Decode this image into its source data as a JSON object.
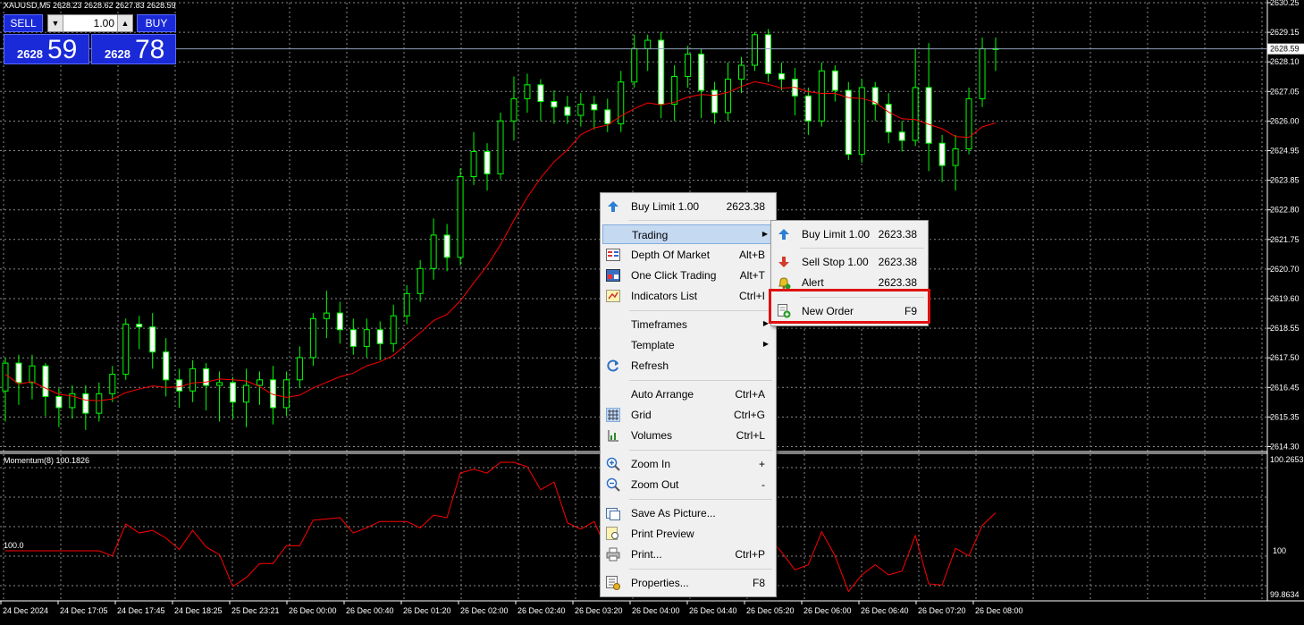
{
  "symbol_header": "XAUUSD,M5  2628.23 2628.62 2627.83 2628.59",
  "trade_panel": {
    "sell_label": "SELL",
    "buy_label": "BUY",
    "lot": "1.00",
    "sell_price_small": "2628",
    "sell_price_big": "59",
    "buy_price_small": "2628",
    "buy_price_big": "78"
  },
  "price_axis": [
    "2630.25",
    "2629.15",
    "2628.10",
    "2627.05",
    "2626.00",
    "2624.95",
    "2623.85",
    "2622.80",
    "2621.75",
    "2620.70",
    "2619.60",
    "2618.55",
    "2617.50",
    "2616.45",
    "2615.35",
    "2614.30"
  ],
  "current_price_label": "2628.59",
  "indicator": {
    "title": "Momentum(8) 100.1826",
    "level_label": "100.0",
    "axis": [
      "100.2653",
      "100",
      "99.8634"
    ]
  },
  "time_axis": [
    "24 Dec 2024",
    "24 Dec 17:05",
    "24 Dec 17:45",
    "24 Dec 18:25",
    "25 Dec 23:21",
    "26 Dec 00:00",
    "26 Dec 00:40",
    "26 Dec 01:20",
    "26 Dec 02:00",
    "26 Dec 02:40",
    "26 Dec 03:20",
    "26 Dec 04:00",
    "26 Dec 04:40",
    "26 Dec 05:20",
    "26 Dec 06:00",
    "26 Dec 06:40",
    "26 Dec 07:20",
    "26 Dec 08:00"
  ],
  "context_menu": {
    "buy_limit": {
      "label": "Buy Limit 1.00",
      "value": "2623.38"
    },
    "trading": "Trading",
    "depth_of_market": {
      "label": "Depth Of Market",
      "shortcut": "Alt+B"
    },
    "one_click_trading": {
      "label": "One Click Trading",
      "shortcut": "Alt+T"
    },
    "indicators_list": {
      "label": "Indicators List",
      "shortcut": "Ctrl+I"
    },
    "timeframes": "Timeframes",
    "template": "Template",
    "refresh": "Refresh",
    "auto_arrange": {
      "label": "Auto Arrange",
      "shortcut": "Ctrl+A"
    },
    "grid": {
      "label": "Grid",
      "shortcut": "Ctrl+G"
    },
    "volumes": {
      "label": "Volumes",
      "shortcut": "Ctrl+L"
    },
    "zoom_in": {
      "label": "Zoom In",
      "shortcut": "+"
    },
    "zoom_out": {
      "label": "Zoom Out",
      "shortcut": "-"
    },
    "save_as_picture": "Save As Picture...",
    "print_preview": "Print Preview",
    "print": {
      "label": "Print...",
      "shortcut": "Ctrl+P"
    },
    "properties": {
      "label": "Properties...",
      "shortcut": "F8"
    }
  },
  "submenu": {
    "buy_limit": {
      "label": "Buy Limit 1.00",
      "value": "2623.38"
    },
    "sell_stop": {
      "label": "Sell Stop 1.00",
      "value": "2623.38"
    },
    "alert": {
      "label": "Alert",
      "value": "2623.38"
    },
    "new_order": {
      "label": "New Order",
      "shortcut": "F9"
    }
  },
  "colors": {
    "bull": "#00ff00",
    "ma": "#ff0000",
    "grid": "#8a8a8a",
    "menu_highlight": "#c5d9f1",
    "callout": "#e01010"
  },
  "chart_data": {
    "type": "candlestick",
    "title": "XAUUSD,M5",
    "ylim": [
      2614.3,
      2630.25
    ],
    "candles": [
      [
        2616.3,
        2617.3,
        2615.2,
        2617.5
      ],
      [
        2617.3,
        2616.6,
        2615.8,
        2617.6
      ],
      [
        2616.6,
        2617.2,
        2616.0,
        2617.6
      ],
      [
        2617.2,
        2616.1,
        2615.4,
        2617.3
      ],
      [
        2616.1,
        2615.7,
        2615.0,
        2616.4
      ],
      [
        2615.7,
        2616.2,
        2615.3,
        2616.5
      ],
      [
        2616.2,
        2615.5,
        2614.9,
        2616.5
      ],
      [
        2615.5,
        2616.2,
        2615.2,
        2616.6
      ],
      [
        2616.2,
        2616.9,
        2615.9,
        2617.2
      ],
      [
        2616.9,
        2618.7,
        2616.7,
        2618.9
      ],
      [
        2618.7,
        2618.6,
        2617.8,
        2619.0
      ],
      [
        2618.6,
        2617.7,
        2617.1,
        2619.1
      ],
      [
        2617.7,
        2616.7,
        2616.1,
        2618.2
      ],
      [
        2616.7,
        2616.3,
        2615.7,
        2617.1
      ],
      [
        2616.3,
        2617.1,
        2615.9,
        2617.4
      ],
      [
        2617.1,
        2616.5,
        2615.6,
        2617.3
      ],
      [
        2616.5,
        2616.6,
        2615.2,
        2617.0
      ],
      [
        2616.6,
        2615.9,
        2615.3,
        2616.8
      ],
      [
        2615.9,
        2616.5,
        2615.0,
        2617.1
      ],
      [
        2616.5,
        2616.7,
        2615.8,
        2617.0
      ],
      [
        2616.7,
        2615.7,
        2615.1,
        2617.2
      ],
      [
        2615.7,
        2616.7,
        2615.4,
        2617.0
      ],
      [
        2616.7,
        2617.5,
        2616.4,
        2617.9
      ],
      [
        2617.5,
        2618.9,
        2617.2,
        2619.1
      ],
      [
        2618.9,
        2619.1,
        2618.2,
        2619.9
      ],
      [
        2619.1,
        2618.5,
        2618.0,
        2619.5
      ],
      [
        2618.5,
        2617.9,
        2617.6,
        2618.9
      ],
      [
        2617.9,
        2618.5,
        2617.5,
        2618.9
      ],
      [
        2618.5,
        2618.0,
        2617.4,
        2618.8
      ],
      [
        2618.0,
        2619.0,
        2617.7,
        2619.4
      ],
      [
        2619.0,
        2619.8,
        2618.7,
        2620.1
      ],
      [
        2619.8,
        2620.7,
        2619.5,
        2621.0
      ],
      [
        2620.7,
        2621.9,
        2620.3,
        2622.5
      ],
      [
        2621.9,
        2621.1,
        2620.6,
        2622.3
      ],
      [
        2621.1,
        2624.0,
        2620.8,
        2624.3
      ],
      [
        2624.0,
        2624.9,
        2623.7,
        2625.6
      ],
      [
        2624.9,
        2624.1,
        2623.5,
        2625.2
      ],
      [
        2624.1,
        2626.0,
        2623.9,
        2626.3
      ],
      [
        2626.0,
        2626.8,
        2625.3,
        2627.6
      ],
      [
        2626.8,
        2627.3,
        2626.3,
        2627.7
      ],
      [
        2627.3,
        2626.7,
        2626.0,
        2627.5
      ],
      [
        2626.7,
        2626.5,
        2625.9,
        2627.1
      ],
      [
        2626.5,
        2626.2,
        2625.9,
        2626.9
      ],
      [
        2626.2,
        2626.6,
        2625.8,
        2627.0
      ],
      [
        2626.6,
        2626.4,
        2625.7,
        2626.9
      ],
      [
        2626.4,
        2625.9,
        2625.6,
        2626.8
      ],
      [
        2625.9,
        2627.4,
        2625.6,
        2627.8
      ],
      [
        2627.4,
        2628.6,
        2627.2,
        2629.1
      ],
      [
        2628.6,
        2628.9,
        2627.8,
        2629.1
      ],
      [
        2628.9,
        2626.6,
        2626.1,
        2629.2
      ],
      [
        2626.6,
        2627.6,
        2626.0,
        2628.0
      ],
      [
        2627.6,
        2628.4,
        2627.2,
        2628.7
      ],
      [
        2628.4,
        2627.1,
        2626.1,
        2628.6
      ],
      [
        2627.1,
        2626.3,
        2625.9,
        2627.4
      ],
      [
        2626.3,
        2627.5,
        2626.0,
        2628.1
      ],
      [
        2627.5,
        2628.0,
        2627.0,
        2628.3
      ],
      [
        2628.0,
        2629.1,
        2627.8,
        2629.2
      ],
      [
        2629.1,
        2627.7,
        2627.4,
        2629.3
      ],
      [
        2627.7,
        2627.5,
        2627.1,
        2628.1
      ],
      [
        2627.5,
        2626.9,
        2626.2,
        2627.9
      ],
      [
        2626.9,
        2626.0,
        2625.5,
        2627.2
      ],
      [
        2626.0,
        2627.8,
        2625.8,
        2628.1
      ],
      [
        2627.8,
        2627.1,
        2626.7,
        2628.0
      ],
      [
        2627.1,
        2624.8,
        2624.6,
        2627.4
      ],
      [
        2624.8,
        2627.2,
        2624.5,
        2627.5
      ],
      [
        2627.2,
        2626.6,
        2626.0,
        2627.4
      ],
      [
        2626.6,
        2625.6,
        2625.2,
        2627.0
      ],
      [
        2625.6,
        2625.3,
        2624.9,
        2626.0
      ],
      [
        2625.3,
        2627.2,
        2625.1,
        2628.6
      ],
      [
        2627.2,
        2625.2,
        2624.2,
        2628.8
      ],
      [
        2625.2,
        2624.4,
        2623.8,
        2625.5
      ],
      [
        2624.4,
        2625.0,
        2623.5,
        2625.5
      ],
      [
        2625.0,
        2626.8,
        2624.8,
        2627.2
      ],
      [
        2626.8,
        2628.6,
        2626.5,
        2629.0
      ],
      [
        2628.6,
        2628.59,
        2627.8,
        2629.0
      ]
    ],
    "ma_period_hidden": true,
    "indicator_series": {
      "name": "Momentum(8)",
      "ylim": [
        99.8634,
        100.2653
      ]
    }
  }
}
